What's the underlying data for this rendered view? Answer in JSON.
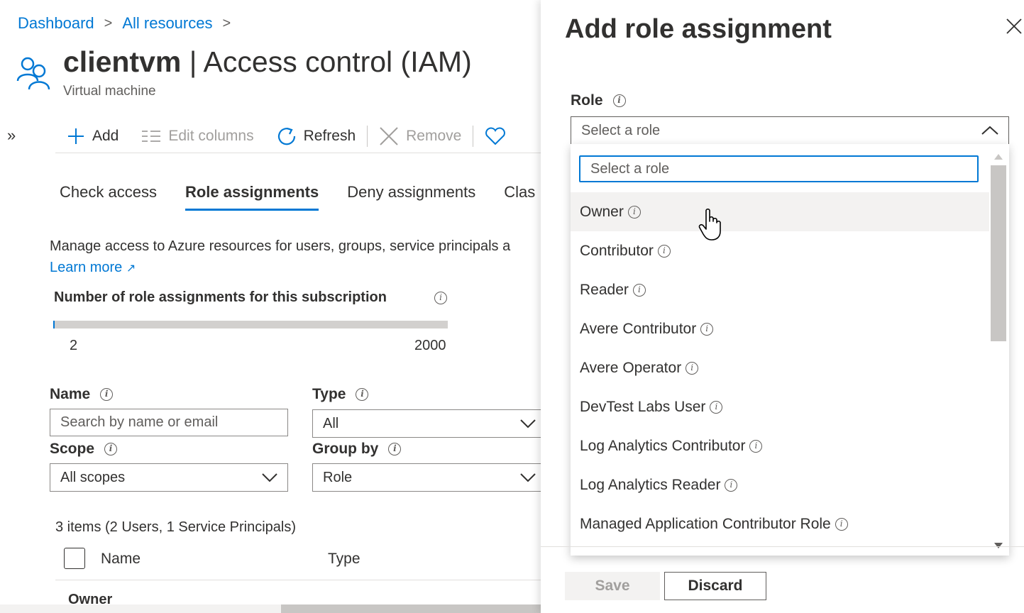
{
  "breadcrumb": {
    "items": [
      "Dashboard",
      "All resources"
    ]
  },
  "resource": {
    "name": "clientvm",
    "title_suffix": "Access control (IAM)",
    "subtitle": "Virtual machine"
  },
  "toolbar": {
    "add": "Add",
    "edit_columns": "Edit columns",
    "refresh": "Refresh",
    "remove": "Remove"
  },
  "tabs": [
    "Check access",
    "Role assignments",
    "Deny assignments",
    "Clas"
  ],
  "description": "Manage access to Azure resources for users, groups, service principals a",
  "learn_more": "Learn more",
  "role_count": {
    "label": "Number of role assignments for this subscription",
    "current": "2",
    "max": "2000",
    "fraction": 0.001
  },
  "filters": {
    "name_label": "Name",
    "name_placeholder": "Search by name or email",
    "type_label": "Type",
    "type_value": "All",
    "scope_label": "Scope",
    "scope_value": "All scopes",
    "groupby_label": "Group by",
    "groupby_value": "Role"
  },
  "items_summary": "3 items (2 Users, 1 Service Principals)",
  "table": {
    "col_name": "Name",
    "col_type": "Type",
    "first_group": "Owner"
  },
  "panel": {
    "title": "Add role assignment",
    "role_label": "Role",
    "role_placeholder": "Select a role",
    "search_placeholder": "Select a role",
    "roles": [
      "Owner",
      "Contributor",
      "Reader",
      "Avere Contributor",
      "Avere Operator",
      "DevTest Labs User",
      "Log Analytics Contributor",
      "Log Analytics Reader",
      "Managed Application Contributor Role"
    ],
    "save": "Save",
    "discard": "Discard"
  },
  "colors": {
    "accent": "#0078d4",
    "text": "#323130",
    "muted": "#605e5c"
  }
}
